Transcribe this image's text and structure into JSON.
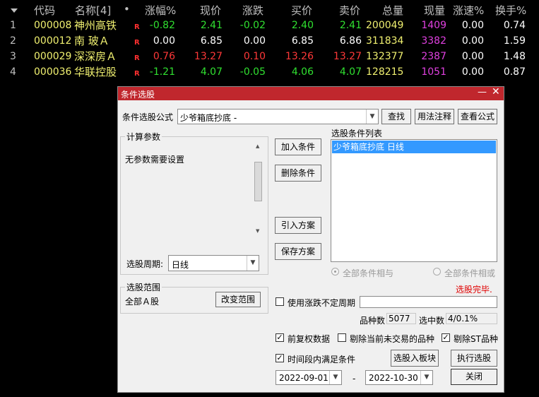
{
  "table": {
    "headers": {
      "code": "代码",
      "name": "名称[4]",
      "dot": "•",
      "change_pct": "涨幅%",
      "price": "现价",
      "change": "涨跌",
      "buy": "买价",
      "sell": "卖价",
      "volume": "总量",
      "cur_volume": "现量",
      "speed": "涨速%",
      "turnover": "换手%"
    },
    "rows": [
      {
        "no": "1",
        "code": "000008",
        "name": "神州高铁",
        "flag": "R",
        "change_pct": "-0.82",
        "price": "2.41",
        "change": "-0.02",
        "buy": "2.40",
        "sell": "2.41",
        "volume": "200049",
        "cur_volume": "1409",
        "speed": "0.00",
        "turnover": "0.74"
      },
      {
        "no": "2",
        "code": "000012",
        "name": "南 玻Ａ",
        "flag": "R",
        "change_pct": "0.00",
        "price": "6.85",
        "change": "0.00",
        "buy": "6.85",
        "sell": "6.86",
        "volume": "311834",
        "cur_volume": "3382",
        "speed": "0.00",
        "turnover": "1.59"
      },
      {
        "no": "3",
        "code": "000029",
        "name": "深深房Ａ",
        "flag": "R",
        "change_pct": "0.76",
        "price": "13.27",
        "change": "0.10",
        "buy": "13.26",
        "sell": "13.27",
        "volume": "132377",
        "cur_volume": "2387",
        "speed": "0.00",
        "turnover": "1.48"
      },
      {
        "no": "4",
        "code": "000036",
        "name": "华联控股",
        "flag": "R",
        "change_pct": "-1.21",
        "price": "4.07",
        "change": "-0.05",
        "buy": "4.06",
        "sell": "4.07",
        "volume": "128215",
        "cur_volume": "1051",
        "speed": "0.00",
        "turnover": "0.87"
      }
    ]
  },
  "dialog": {
    "title": "条件选股",
    "formula_label": "条件选股公式",
    "formula_value": "少爷箱底抄底 -",
    "find_button": "查找",
    "usage_button": "用法注释",
    "view_formula_button": "查看公式",
    "params_group": "计算参数",
    "params_text": "无参数需要设置",
    "period_label": "选股周期:",
    "period_value": "日线",
    "add_condition": "加入条件",
    "delete_condition": "删除条件",
    "import_scheme": "引入方案",
    "save_scheme": "保存方案",
    "condition_list_label": "选股条件列表",
    "condition_items": [
      "少爷箱底抄底  日线"
    ],
    "radio_all_and": "全部条件相与",
    "radio_all_or": "全部条件相或",
    "status_text": "选股完毕.",
    "range_group": "选股范围",
    "range_value": "全部Ａ股",
    "change_range": "改变范围",
    "use_uncertain_period": "使用涨跌不定周期",
    "count_label": "品种数",
    "count_value": "5077",
    "selected_label": "选中数",
    "selected_value": "4/0.1%",
    "fq_data": "前复权数据",
    "remove_untraded": "剔除当前未交易的品种",
    "remove_st": "剔除ST品种",
    "time_range_cond": "时间段内满足条件",
    "select_to_block": "选股入板块",
    "execute_select": "执行选股",
    "date_start": "2022-09-01",
    "date_sep": "-",
    "date_end": "2022-10-30",
    "close": "关闭"
  }
}
